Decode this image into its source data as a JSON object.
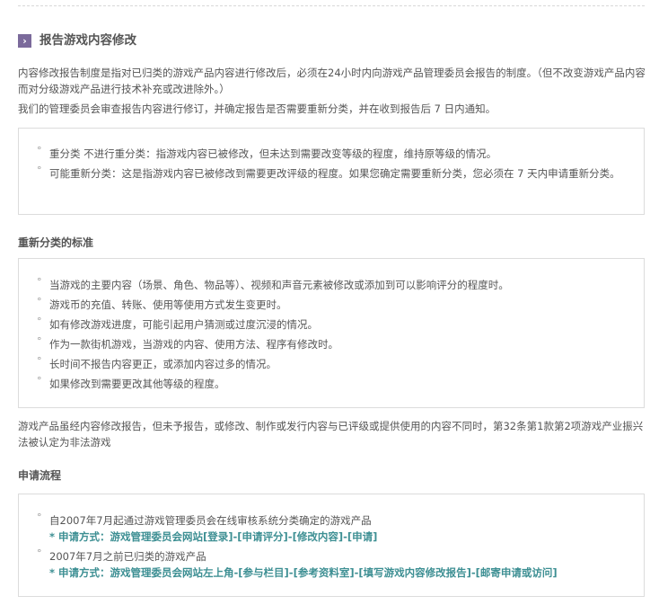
{
  "section": {
    "title": "报告游戏内容修改"
  },
  "intro": {
    "p1": "内容修改报告制度是指对已归类的游戏产品内容进行修改后，必须在24小时内向游戏产品管理委员会报告的制度。（但不改变游戏产品内容而对分级游戏产品进行技术补充或改进除外。）",
    "p2": "我们的管理委员会审查报告内容进行修订，并确定报告是否需要重新分类，并在收到报告后 7 日内通知。"
  },
  "classification_box": {
    "items": [
      "重分类 不进行重分类：指游戏内容已被修改，但未达到需要改变等级的程度，维持原等级的情况。",
      "可能重新分类：这是指游戏内容已被修改到需要更改评级的程度。如果您确定需要重新分类，您必须在 7 天内申请重新分类。"
    ]
  },
  "criteria": {
    "heading": "重新分类的标准",
    "items": [
      "当游戏的主要内容（场景、角色、物品等）、视频和声音元素被修改或添加到可以影响评分的程度时。",
      "游戏币的充值、转账、使用等使用方式发生变更时。",
      "如有修改游戏进度，可能引起用户猜测或过度沉浸的情况。",
      "作为一款街机游戏，当游戏的内容、使用方法、程序有修改时。",
      "长时间不报告内容更正，或添加内容过多的情况。",
      "如果修改到需要更改其他等级的程度。"
    ]
  },
  "note": {
    "text": "游戏产品虽经内容修改报告，但未予报告，或修改、制作或发行内容与已评级或提供使用的内容不同时，第32条第1款第2项游戏产业振兴法被认定为非法游戏"
  },
  "process": {
    "heading": "申请流程",
    "items": [
      {
        "text": "自2007年7月起通过游戏管理委员会在线审核系统分类确定的游戏产品",
        "method": "* 申请方式：游戏管理委员会网站[登录]-[申请评分]-[修改内容]-[申请]"
      },
      {
        "text": "2007年7月之前已归类的游戏产品",
        "method": "* 申请方式：游戏管理委员会网站左上角-[参与栏目]-[参考资料室]-[填写游戏内容修改报告]-[邮寄申请或访问]"
      }
    ]
  },
  "colors": {
    "accent": "#7b6a9b",
    "link": "#3d8f93",
    "border": "#dcdcdc"
  }
}
